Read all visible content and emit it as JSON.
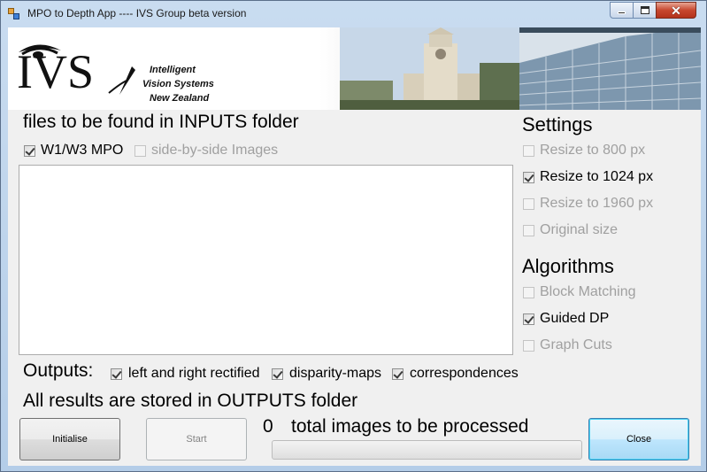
{
  "window": {
    "title": "MPO to Depth App ---- IVS Group beta version",
    "controls": [
      "minimize-icon",
      "maximize-icon",
      "close-icon"
    ],
    "close_glyph": "✕"
  },
  "banner": {
    "logo_letters": "IVS",
    "tagline": [
      "Intelligent",
      "Vision Systems",
      "New Zealand"
    ]
  },
  "inputs": {
    "heading": "files to be found in INPUTS folder",
    "types": [
      {
        "label": "W1/W3 MPO",
        "checked": true,
        "enabled": true
      },
      {
        "label": "side-by-side Images",
        "checked": false,
        "enabled": false
      }
    ]
  },
  "settings": {
    "heading": "Settings",
    "options": [
      {
        "label": "Resize to 800 px",
        "checked": false,
        "enabled": false
      },
      {
        "label": "Resize to 1024 px",
        "checked": true,
        "enabled": true
      },
      {
        "label": "Resize to 1960 px",
        "checked": false,
        "enabled": false
      },
      {
        "label": "Original size",
        "checked": false,
        "enabled": false
      }
    ]
  },
  "algorithms": {
    "heading": "Algorithms",
    "options": [
      {
        "label": "Block Matching",
        "checked": false,
        "enabled": false
      },
      {
        "label": "Guided DP",
        "checked": true,
        "enabled": true
      },
      {
        "label": "Graph Cuts",
        "checked": false,
        "enabled": false
      }
    ]
  },
  "outputs": {
    "label": "Outputs:",
    "options": [
      {
        "label": "left and right rectified",
        "checked": true
      },
      {
        "label": "disparity-maps",
        "checked": true
      },
      {
        "label": "correspondences",
        "checked": true
      }
    ],
    "note": "All results are stored in OUTPUTS folder"
  },
  "status": {
    "count": "0",
    "text": "total images to be processed",
    "progress": 0
  },
  "buttons": {
    "initialise": "Initialise",
    "start": "Start",
    "close": "Close"
  },
  "colors": {
    "accent": "#3c7fb1",
    "progress_fill": "#06b025",
    "disabled_text": "#a0a0a0"
  }
}
